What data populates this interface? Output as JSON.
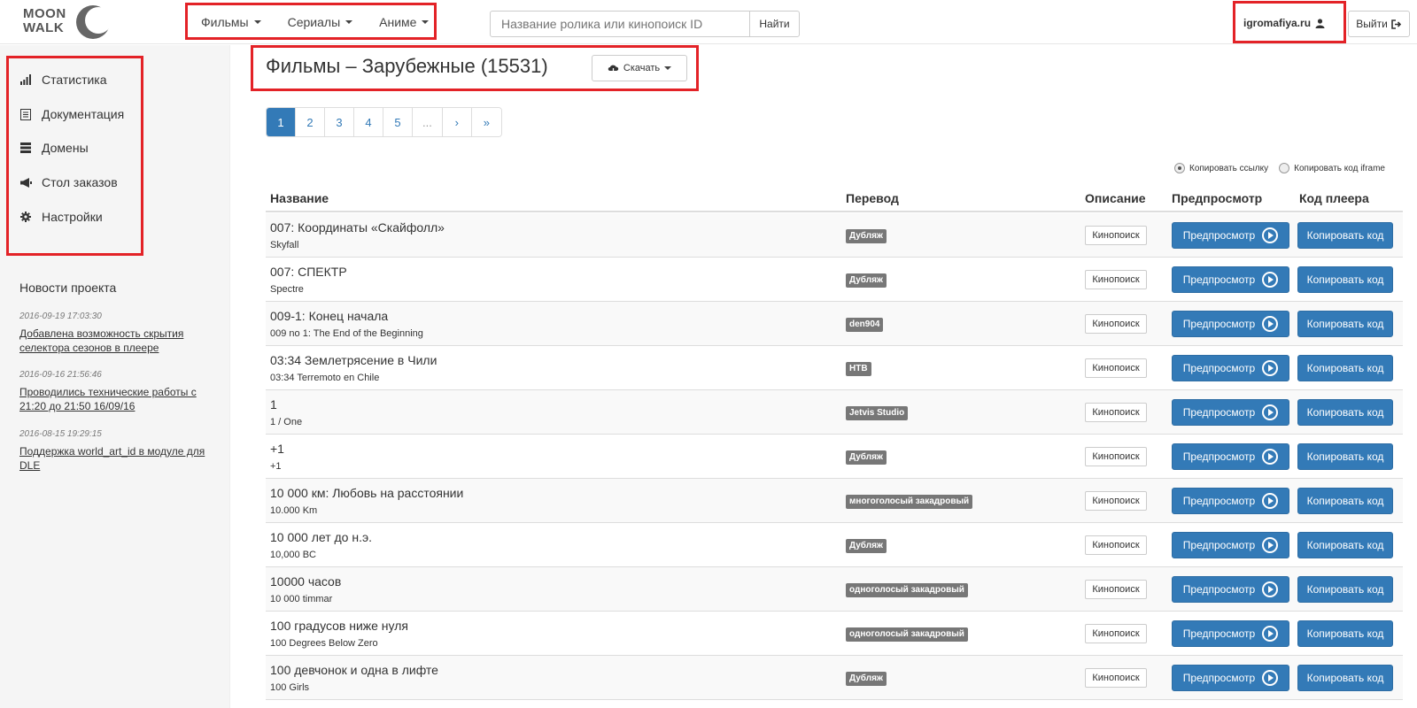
{
  "brand": {
    "logo_line1": "MOON",
    "logo_line2": "WALK"
  },
  "nav": {
    "menu": [
      {
        "label": "Фильмы"
      },
      {
        "label": "Сериалы"
      },
      {
        "label": "Аниме"
      }
    ],
    "search_placeholder": "Название ролика или кинопоиск ID",
    "search_button": "Найти",
    "user": "igromafiya.ru",
    "logout": "Выйти"
  },
  "sidebar": {
    "items": [
      {
        "label": "Статистика",
        "icon": "bar-chart-icon"
      },
      {
        "label": "Документация",
        "icon": "document-icon"
      },
      {
        "label": "Домены",
        "icon": "server-icon"
      },
      {
        "label": "Стол заказов",
        "icon": "megaphone-icon"
      },
      {
        "label": "Настройки",
        "icon": "gear-icon"
      }
    ],
    "news_title": "Новости проекта",
    "news": [
      {
        "date": "2016-09-19 17:03:30",
        "text": "Добавлена возможность скрытия селектора сезонов в плеере"
      },
      {
        "date": "2016-09-16 21:56:46",
        "text": "Проводились технические работы с 21:20 до 21:50 16/09/16"
      },
      {
        "date": "2016-08-15 19:29:15",
        "text": "Поддержка world_art_id в модуле для DLE"
      }
    ]
  },
  "main": {
    "title": "Фильмы – Зарубежные (15531)",
    "download_button": "Скачать",
    "pagination": [
      "1",
      "2",
      "3",
      "4",
      "5",
      "...",
      "›",
      "»"
    ],
    "copy_options": {
      "link": "Копировать ссылку",
      "iframe": "Копировать код iframe",
      "selected": "link"
    },
    "columns": [
      "Название",
      "Перевод",
      "Описание",
      "Предпросмотр",
      "Код плеера"
    ],
    "kinopoisk_label": "Кинопоиск",
    "preview_label": "Предпросмотр",
    "copy_code_label": "Копировать код",
    "rows": [
      {
        "title": "007: Координаты «Скайфолл»",
        "original": "Skyfall",
        "translation": "Дубляж"
      },
      {
        "title": "007: СПЕКТР",
        "original": "Spectre",
        "translation": "Дубляж"
      },
      {
        "title": "009-1: Конец начала",
        "original": "009 no 1: The End of the Beginning",
        "translation": "den904"
      },
      {
        "title": "03:34 Землетрясение в Чили",
        "original": "03:34 Terremoto en Chile",
        "translation": "НТВ"
      },
      {
        "title": "1",
        "original": "1 / One",
        "translation": "Jetvis Studio"
      },
      {
        "title": "+1",
        "original": "+1",
        "translation": "Дубляж"
      },
      {
        "title": "10 000 км: Любовь на расстоянии",
        "original": "10.000 Km",
        "translation": "многоголосый закадровый"
      },
      {
        "title": "10 000 лет до н.э.",
        "original": "10,000 BC",
        "translation": "Дубляж"
      },
      {
        "title": "10000 часов",
        "original": "10 000 timmar",
        "translation": "одноголосый закадровый"
      },
      {
        "title": "100 градусов ниже нуля",
        "original": "100 Degrees Below Zero",
        "translation": "одноголосый закадровый"
      },
      {
        "title": "100 девчонок и одна в лифте",
        "original": "100 Girls",
        "translation": "Дубляж"
      }
    ]
  }
}
